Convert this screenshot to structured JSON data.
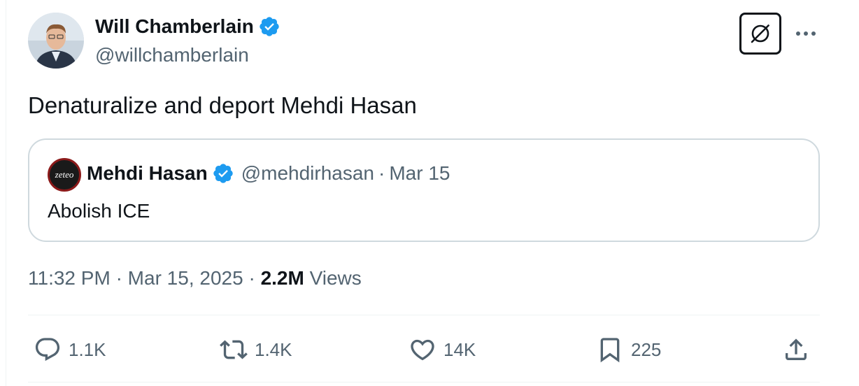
{
  "author": {
    "name": "Will Chamberlain",
    "handle": "@willchamberlain",
    "verified": true
  },
  "tweet": {
    "text": "Denaturalize and deport Mehdi Hasan"
  },
  "quoted_tweet": {
    "avatar_text": "zeteo",
    "name": "Mehdi Hasan",
    "handle": "@mehdirhasan",
    "separator": "·",
    "date": "Mar 15",
    "text": "Abolish ICE"
  },
  "meta": {
    "time": "11:32 PM",
    "separator": "·",
    "date": "Mar 15, 2025",
    "views_count": "2.2M",
    "views_label": "Views"
  },
  "actions": {
    "replies": "1.1K",
    "reposts": "1.4K",
    "likes": "14K",
    "bookmarks": "225"
  },
  "colors": {
    "verified": "#1d9bf0",
    "secondary_text": "#536471",
    "border": "#cfd9de"
  },
  "icons": [
    "grok-icon",
    "more-icon",
    "reply-icon",
    "repost-icon",
    "like-icon",
    "bookmark-icon",
    "share-icon",
    "verified-badge-icon"
  ]
}
